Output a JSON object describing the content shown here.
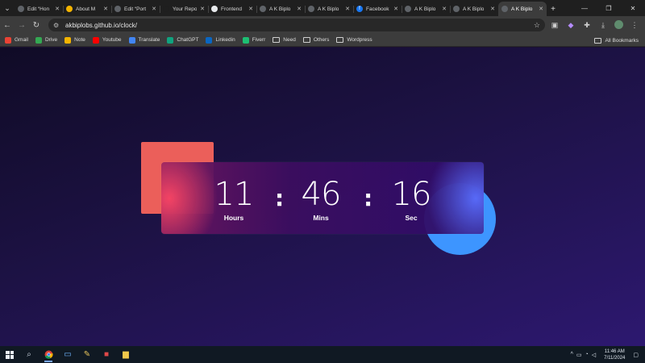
{
  "browser": {
    "tabs": [
      {
        "title": "Edit “Hon",
        "icon": "wordpress-icon",
        "color": "#5f6368"
      },
      {
        "title": "About M",
        "icon": "smile-icon",
        "color": "#f4b400"
      },
      {
        "title": "Edit “Port",
        "icon": "wordpress-icon",
        "color": "#5f6368"
      },
      {
        "title": "Your Repo",
        "icon": "github-icon",
        "color": "#1f1f1f"
      },
      {
        "title": "Frontend",
        "icon": "globe-icon",
        "color": "#e8eaed"
      },
      {
        "title": "A K Biplo",
        "icon": "globe-icon",
        "color": "#5f6368"
      },
      {
        "title": "A K Biplo",
        "icon": "globe-icon",
        "color": "#5f6368"
      },
      {
        "title": "Facebook",
        "icon": "facebook-icon",
        "color": "#1877f2"
      },
      {
        "title": "A K Biplo",
        "icon": "globe-icon",
        "color": "#5f6368"
      },
      {
        "title": "A K Biplo",
        "icon": "globe-icon",
        "color": "#5f6368"
      },
      {
        "title": "A K Biplo",
        "icon": "globe-icon",
        "color": "#5f6368",
        "active": true
      }
    ],
    "url": "akbiplobs.github.io/clock/",
    "bookmarks": [
      {
        "label": "Gmail",
        "icon": "gmail-icon",
        "color": "#ea4335"
      },
      {
        "label": "Drive",
        "icon": "drive-icon",
        "color": "#34a853"
      },
      {
        "label": "Note",
        "icon": "note-icon",
        "color": "#f4b400"
      },
      {
        "label": "Youtube",
        "icon": "youtube-icon",
        "color": "#ff0000"
      },
      {
        "label": "Translate",
        "icon": "translate-icon",
        "color": "#4285f4"
      },
      {
        "label": "ChatGPT",
        "icon": "chatgpt-icon",
        "color": "#10a37f"
      },
      {
        "label": "Linkedin",
        "icon": "linkedin-icon",
        "color": "#0a66c2"
      },
      {
        "label": "Fiverr",
        "icon": "fiverr-icon",
        "color": "#1dbf73"
      },
      {
        "label": "Need",
        "icon": "folder-icon",
        "color": ""
      },
      {
        "label": "Others",
        "icon": "folder-icon",
        "color": ""
      },
      {
        "label": "Wordpress",
        "icon": "folder-icon",
        "color": ""
      }
    ],
    "all_bookmarks": "All Bookmarks"
  },
  "clock": {
    "hours": "11",
    "minutes": "46",
    "seconds": "16",
    "separator": ":",
    "hours_label": "Hours",
    "minutes_label": "Mins",
    "seconds_label": "Sec"
  },
  "taskbar": {
    "time": "11:46 AM",
    "date": "7/11/2024"
  },
  "colors": {
    "square": "#eb5f5a",
    "circle": "#3d95ff"
  }
}
